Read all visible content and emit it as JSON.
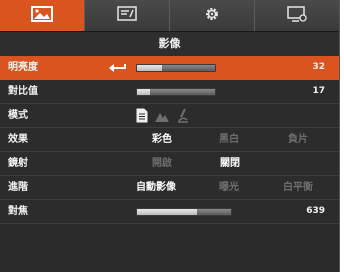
{
  "tabs": [
    {
      "icon": "image-icon",
      "active": true
    },
    {
      "icon": "presentation-icon",
      "active": false
    },
    {
      "icon": "gear-icon",
      "active": false
    },
    {
      "icon": "monitor-settings-icon",
      "active": false
    }
  ],
  "header": {
    "title": "影像"
  },
  "rows": {
    "brightness": {
      "label": "明亮度",
      "value": "32",
      "level": 0.32
    },
    "contrast": {
      "label": "對比值",
      "value": "17",
      "level": 0.17
    },
    "mode": {
      "label": "模式",
      "icons": [
        "document-icon",
        "landscape-icon",
        "microscope-icon"
      ]
    },
    "effect": {
      "label": "效果",
      "options": [
        "彩色",
        "黑白",
        "負片"
      ],
      "selected": 0
    },
    "mirror": {
      "label": "鏡射",
      "options": [
        "開啟",
        "關閉"
      ],
      "selected": 1
    },
    "advanced": {
      "label": "進階",
      "options": [
        "自動影像",
        "曝光",
        "白平衡"
      ],
      "selected": 0
    },
    "focus": {
      "label": "對焦",
      "value": "639",
      "level": 0.639
    }
  },
  "colors": {
    "accent": "#d9541f",
    "background": "#2a2a2a"
  }
}
